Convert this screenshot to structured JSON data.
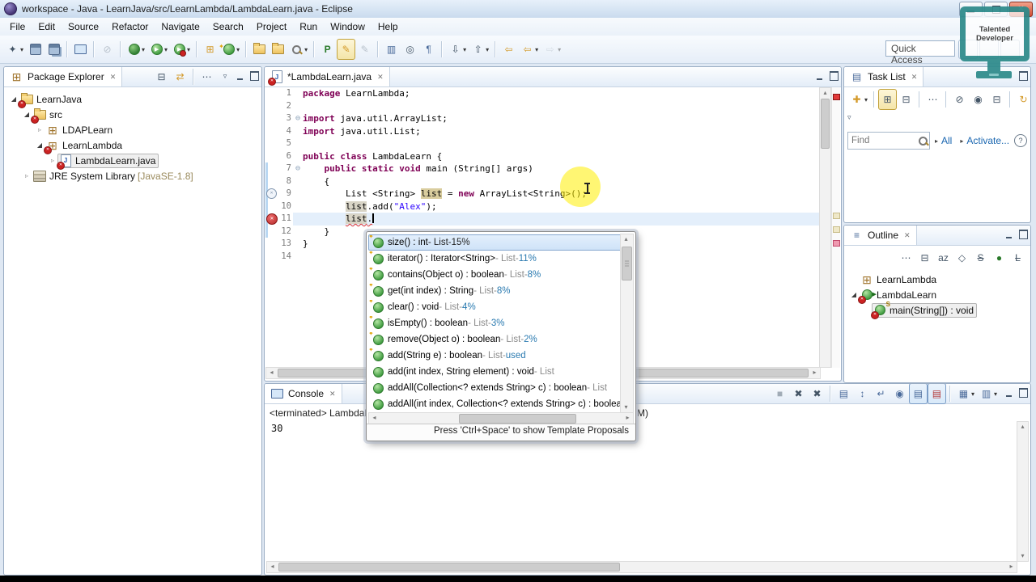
{
  "window": {
    "title": "workspace - Java - LearnJava/src/LearnLambda/LambdaLearn.java - Eclipse"
  },
  "menu": {
    "items": [
      "File",
      "Edit",
      "Source",
      "Refactor",
      "Navigate",
      "Search",
      "Project",
      "Run",
      "Window",
      "Help"
    ]
  },
  "toolbar": {
    "quick_access": "Quick Access",
    "groups": [
      [
        {
          "n": "new-wizard",
          "dd": true
        },
        {
          "n": "save"
        },
        {
          "n": "save-all"
        }
      ],
      [
        {
          "n": "open-console-view"
        }
      ],
      [
        {
          "n": "skip-breakpoints"
        }
      ],
      [
        {
          "n": "debug",
          "dd": true
        },
        {
          "n": "run",
          "dd": true
        },
        {
          "n": "run-last",
          "dd": true
        }
      ],
      [
        {
          "n": "new-java-project"
        },
        {
          "n": "new-class",
          "dd": true
        }
      ],
      [
        {
          "n": "open-task"
        },
        {
          "n": "open-resource"
        },
        {
          "n": "search",
          "dd": true
        }
      ],
      [
        {
          "n": "external-tools"
        },
        {
          "n": "mark-occurrences",
          "active": true
        },
        {
          "n": "trace"
        }
      ],
      [
        {
          "n": "open-declaration"
        },
        {
          "n": "show-source-of-selected"
        },
        {
          "n": "show-whitespace"
        }
      ],
      [
        {
          "n": "next-annotation",
          "dd": true
        },
        {
          "n": "previous-annotation",
          "dd": true
        }
      ],
      [
        {
          "n": "last-edit-location"
        },
        {
          "n": "back",
          "dd": true
        },
        {
          "n": "forward",
          "dd": true,
          "disabled": true
        }
      ]
    ]
  },
  "watermark": {
    "line1": "Talented",
    "line2": "Developer"
  },
  "package_explorer": {
    "title": "Package Explorer",
    "toolbar": [
      [
        {
          "n": "collapse-all"
        },
        {
          "n": "link-with-editor"
        }
      ],
      [
        {
          "n": "focus"
        }
      ]
    ],
    "items": [
      {
        "label": "LearnJava",
        "icon": "project",
        "depth": 0,
        "exp": "open",
        "error": true
      },
      {
        "label": "src",
        "icon": "src",
        "depth": 1,
        "exp": "open",
        "error": true
      },
      {
        "label": "LDAPLearn",
        "icon": "package",
        "depth": 2,
        "exp": "closed"
      },
      {
        "label": "LearnLambda",
        "icon": "package",
        "depth": 2,
        "exp": "open",
        "error": true
      },
      {
        "label": "LambdaLearn.java",
        "icon": "jfile",
        "depth": 3,
        "exp": "closed",
        "error": true,
        "selected": true
      },
      {
        "label": "JRE System Library",
        "suffix": "[JavaSE-1.8]",
        "icon": "library",
        "depth": 1,
        "exp": "closed"
      }
    ]
  },
  "editor": {
    "tab": "*LambdaLearn.java",
    "lines": [
      {
        "n": 1,
        "seg": [
          [
            "kw",
            "package"
          ],
          [
            "pl",
            " LearnLambda;"
          ]
        ]
      },
      {
        "n": 2,
        "seg": []
      },
      {
        "n": 3,
        "fold": true,
        "seg": [
          [
            "kw",
            "import"
          ],
          [
            "pl",
            " java.util.ArrayList;"
          ]
        ]
      },
      {
        "n": 4,
        "seg": [
          [
            "kw",
            "import"
          ],
          [
            "pl",
            " java.util.List;"
          ]
        ]
      },
      {
        "n": 5,
        "seg": []
      },
      {
        "n": 6,
        "seg": [
          [
            "kw",
            "public"
          ],
          [
            "pl",
            " "
          ],
          [
            "kw",
            "class"
          ],
          [
            "pl",
            " LambdaLearn {"
          ]
        ]
      },
      {
        "n": 7,
        "fold": true,
        "range": true,
        "seg": [
          [
            "pl",
            "    "
          ],
          [
            "kw",
            "public"
          ],
          [
            "pl",
            " "
          ],
          [
            "kw",
            "static"
          ],
          [
            "pl",
            " "
          ],
          [
            "kw",
            "void"
          ],
          [
            "pl",
            " main (String[] args)"
          ]
        ]
      },
      {
        "n": 8,
        "range": true,
        "seg": [
          [
            "pl",
            "    {"
          ]
        ]
      },
      {
        "n": 9,
        "range": true,
        "marker": "warn",
        "seg": [
          [
            "pl",
            "        List <String> "
          ],
          [
            "hlw",
            "list"
          ],
          [
            "pl",
            " = "
          ],
          [
            "kw",
            "new"
          ],
          [
            "pl",
            " ArrayList<String>();"
          ]
        ]
      },
      {
        "n": 10,
        "range": true,
        "seg": [
          [
            "pl",
            "        "
          ],
          [
            "hl",
            "list"
          ],
          [
            "pl",
            ".add("
          ],
          [
            "str",
            "\"Alex\""
          ],
          [
            "pl",
            ");"
          ]
        ]
      },
      {
        "n": 11,
        "range": true,
        "marker": "err",
        "current": true,
        "seg": [
          [
            "pl",
            "        "
          ],
          [
            "errhl",
            "list"
          ],
          [
            "errpl",
            "."
          ],
          [
            "caret",
            ""
          ]
        ]
      },
      {
        "n": 12,
        "range": true,
        "seg": [
          [
            "pl",
            "    }"
          ]
        ]
      },
      {
        "n": 13,
        "seg": [
          [
            "pl",
            "}"
          ]
        ]
      },
      {
        "n": 14,
        "seg": []
      }
    ]
  },
  "completion": {
    "items": [
      {
        "icon": "method-star",
        "sig": "size() : int",
        "host": "List",
        "pct": "15%",
        "selected": true
      },
      {
        "icon": "method-star",
        "sig": "iterator() : Iterator<String>",
        "host": "List",
        "pct": "11%"
      },
      {
        "icon": "method-star",
        "sig": "contains(Object o) : boolean",
        "host": "List",
        "pct": "8%"
      },
      {
        "icon": "method-star",
        "sig": "get(int index) : String",
        "host": "List",
        "pct": "8%"
      },
      {
        "icon": "method-star",
        "sig": "clear() : void",
        "host": "List",
        "pct": "4%"
      },
      {
        "icon": "method-star",
        "sig": "isEmpty() : boolean",
        "host": "List",
        "pct": "3%"
      },
      {
        "icon": "method-star",
        "sig": "remove(Object o) : boolean",
        "host": "List",
        "pct": "2%"
      },
      {
        "icon": "method-star",
        "sig": "add(String e) : boolean",
        "host": "List",
        "pct": "used"
      },
      {
        "icon": "method",
        "sig": "add(int index, String element) : void",
        "host": "List"
      },
      {
        "icon": "method",
        "sig": "addAll(Collection<? extends String> c) : boolean",
        "host": "List"
      },
      {
        "icon": "method",
        "sig": "addAll(int index, Collection<? extends String> c) : boolean",
        "host": "List"
      }
    ],
    "hint": "Press 'Ctrl+Space' to show Template Proposals"
  },
  "task_list": {
    "title": "Task List",
    "toolbar": [
      [
        {
          "n": "new-task",
          "dd": true
        }
      ],
      [
        {
          "n": "categorized",
          "active": true
        },
        {
          "n": "scheduled"
        }
      ],
      [
        {
          "n": "focus"
        }
      ],
      [
        {
          "n": "hide-completed"
        },
        {
          "n": "group-by-owner"
        },
        {
          "n": "collapse-all"
        }
      ],
      [
        {
          "n": "synchronize"
        }
      ]
    ],
    "find_placeholder": "Find",
    "link_all": "All",
    "link_activate": "Activate..."
  },
  "outline": {
    "title": "Outline",
    "toolbar": [
      [
        {
          "n": "focus"
        },
        {
          "n": "collapse-all"
        },
        {
          "n": "sort"
        },
        {
          "n": "hide-fields"
        },
        {
          "n": "hide-static"
        },
        {
          "n": "hide-non-public"
        },
        {
          "n": "hide-local-types"
        }
      ]
    ],
    "items": [
      {
        "label": "LearnLambda",
        "icon": "package",
        "depth": 0
      },
      {
        "label": "LambdaLearn",
        "icon": "class-run",
        "depth": 0,
        "exp": "open",
        "error": true
      },
      {
        "label": "main(String[]) : void",
        "icon": "method-static",
        "depth": 1,
        "error": true,
        "selected": true
      }
    ]
  },
  "console": {
    "title": "Console",
    "toolbar": [
      [
        {
          "n": "terminate",
          "disabled": true
        },
        {
          "n": "remove-launch"
        },
        {
          "n": "remove-all-launches"
        }
      ],
      [
        {
          "n": "clear-console"
        },
        {
          "n": "scroll-lock"
        },
        {
          "n": "word-wrap"
        },
        {
          "n": "pin-console"
        },
        {
          "n": "show-stdout",
          "framed": true
        },
        {
          "n": "show-stderr",
          "framed": true
        }
      ],
      [
        {
          "n": "open-console",
          "dd": true
        },
        {
          "n": "display-selected",
          "dd": true
        }
      ]
    ],
    "status_left": "<terminated> LambdaLe",
    "status_right": "M)",
    "output": "30"
  },
  "colors": {
    "keyword": "#7f0055",
    "string": "#2a00ff",
    "error_red": "#cc2222",
    "watermark_teal": "#2e8b8b",
    "selection_blue": "#cfe3f8",
    "pct_teal": "#2a7ab0"
  }
}
